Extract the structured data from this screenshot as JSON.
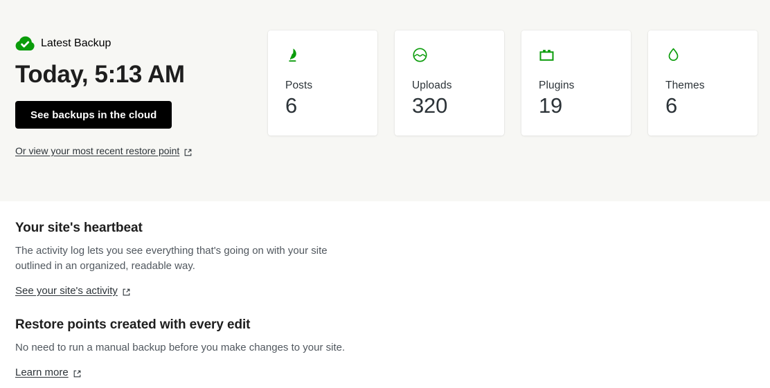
{
  "hero": {
    "background_color": "#f7f7f4",
    "status": {
      "icon": "cloud-check-icon",
      "icon_color": "#0a9c0a",
      "label": "Latest Backup"
    },
    "heading": "Today, 5:13 AM",
    "cta": {
      "label": "See backups in the cloud",
      "background_color": "#000000",
      "text_color": "#ffffff"
    },
    "restore_link": {
      "label": "Or view your most recent restore point",
      "icon": "external-link-icon"
    }
  },
  "stats": {
    "accent_color": "#0a9c0a",
    "cards": [
      {
        "icon": "quill-pen-icon",
        "label": "Posts",
        "value": "6"
      },
      {
        "icon": "media-image-icon",
        "label": "Uploads",
        "value": "320"
      },
      {
        "icon": "plugin-brick-icon",
        "label": "Plugins",
        "value": "19"
      },
      {
        "icon": "droplet-icon",
        "label": "Themes",
        "value": "6"
      }
    ]
  },
  "content": {
    "blocks": [
      {
        "heading": "Your site's heartbeat",
        "body": "The activity log lets you see everything that's going on with your site outlined in an organized, readable way.",
        "link": {
          "label": "See your site's activity",
          "icon": "external-link-icon"
        }
      },
      {
        "heading": "Restore points created with every edit",
        "body": "No need to run a manual backup before you make changes to your site.",
        "link": {
          "label": "Learn more",
          "icon": "external-link-icon"
        }
      }
    ]
  }
}
